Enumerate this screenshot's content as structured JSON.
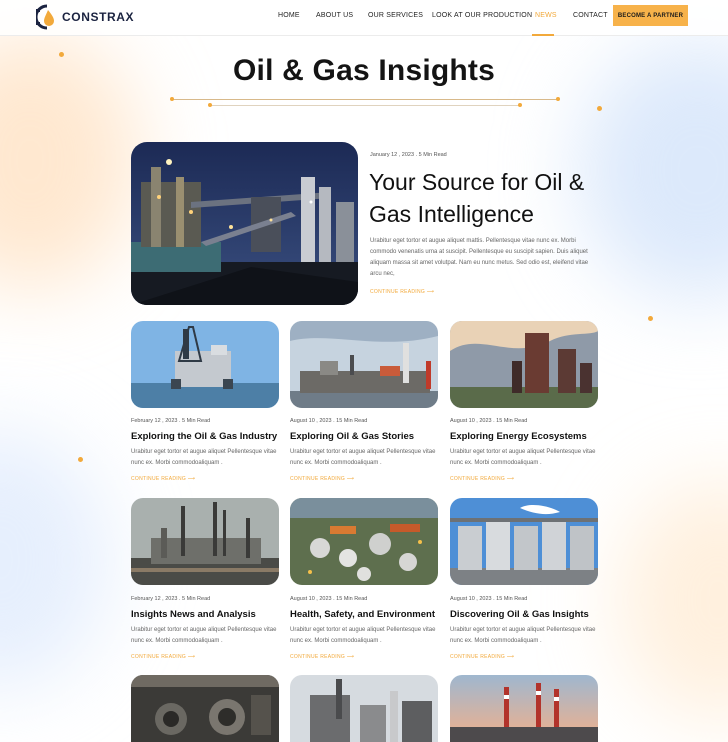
{
  "brand": {
    "name": "CONSTRAX"
  },
  "nav": {
    "items": [
      "HOME",
      "ABOUT US",
      "OUR SERVICES",
      "LOOK AT OUR PRODUCTION",
      "NEWS",
      "CONTACT"
    ],
    "active": "NEWS",
    "cta": "BECOME A PARTNER"
  },
  "page_title": "Oil & Gas Insights",
  "featured": {
    "meta": "January 12 , 2023  .  5 Min Read",
    "title": "Your Source for Oil & Gas Intelligence",
    "excerpt": "Urabitur eget tortor et augue aliquet mattis. Pellentesque vitae nunc ex. Morbi commodo venenatis urna at suscipit. Pellentesque eu suscipit sapien. Duis aliquet aliquam massa sit amet volutpat. Nam eu nunc metus. Sed odio est, eleifend vitae arcu nec,",
    "cta": "CONTINUE READING ⟶"
  },
  "posts": [
    {
      "meta": "February 12 , 2023  .  5 Min Read",
      "title": "Exploring the Oil & Gas Industry",
      "excerpt": "Urabitur eget tortor et augue aliquet Pellentesque vitae nunc ex. Morbi commodoaliquam .",
      "cta": "CONTINUE READING ⟶",
      "image": "offshore-rig"
    },
    {
      "meta": "August 10 , 2023  .  15 Min Read",
      "title": "Exploring Oil & Gas Stories",
      "excerpt": "Urabitur eget tortor et augue aliquet Pellentesque vitae nunc ex. Morbi commodoaliquam .",
      "cta": "CONTINUE READING ⟶",
      "image": "refinery-coast"
    },
    {
      "meta": "August 10 , 2023  .  15 Min Read",
      "title": "Exploring Energy Ecosystems",
      "excerpt": "Urabitur eget tortor et augue aliquet Pellentesque vitae nunc ex. Morbi commodoaliquam .",
      "cta": "CONTINUE READING ⟶",
      "image": "rusty-plant"
    },
    {
      "meta": "February 12 , 2023  .  5 Min Read",
      "title": "Insights News and Analysis",
      "excerpt": "Urabitur eget tortor et augue aliquet Pellentesque vitae nunc ex. Morbi commodoaliquam .",
      "cta": "CONTINUE READING ⟶",
      "image": "smokestacks"
    },
    {
      "meta": "August 10 , 2023  .  15 Min Read",
      "title": "Health, Safety, and Environment",
      "excerpt": "Urabitur eget tortor et augue aliquet Pellentesque vitae nunc ex. Morbi commodoaliquam .",
      "cta": "CONTINUE READING ⟶",
      "image": "tank-farm"
    },
    {
      "meta": "August 10 , 2023  .  15 Min Read",
      "title": "Discovering Oil & Gas Insights",
      "excerpt": "Urabitur eget tortor et augue aliquet Pellentesque vitae nunc ex. Morbi commodoaliquam .",
      "cta": "CONTINUE READING ⟶",
      "image": "steel-silos"
    }
  ],
  "colors": {
    "accent": "#f2a93b",
    "button": "#f7b24a",
    "navy": "#1b2340"
  }
}
